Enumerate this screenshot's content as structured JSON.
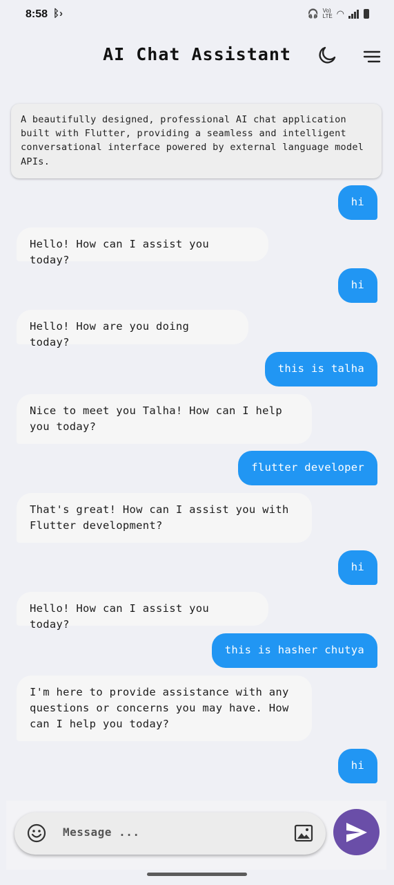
{
  "status_bar": {
    "time": "8:58",
    "network_label": "Vo) LTE"
  },
  "header": {
    "title": "AI Chat Assistant"
  },
  "description": "A beautifully designed, professional AI chat application built with Flutter, providing a seamless and intelligent conversational interface powered by external language model APIs.",
  "messages": [
    {
      "role": "user",
      "text": "hi"
    },
    {
      "role": "assistant",
      "text": "Hello! How can I assist you today?"
    },
    {
      "role": "user",
      "text": "hi"
    },
    {
      "role": "assistant",
      "text": "Hello! How are you doing today?"
    },
    {
      "role": "user",
      "text": "this is talha"
    },
    {
      "role": "assistant",
      "text": "Nice to meet you Talha! How can I help you today?"
    },
    {
      "role": "user",
      "text": "flutter developer"
    },
    {
      "role": "assistant",
      "text": "That's great! How can I assist you with Flutter development?"
    },
    {
      "role": "user",
      "text": "hi"
    },
    {
      "role": "assistant",
      "text": "Hello! How can I assist you today?"
    },
    {
      "role": "user",
      "text": "this is hasher chutya"
    },
    {
      "role": "assistant",
      "text": "I'm here to provide assistance with any questions or concerns you may have. How can I help you today?"
    },
    {
      "role": "user",
      "text": "hi"
    }
  ],
  "composer": {
    "placeholder": "Message ..."
  },
  "colors": {
    "user_bubble": "#2196f3",
    "bot_bubble": "#f6f6f6",
    "send_button": "#6a4ea8",
    "background": "#eff0f5"
  },
  "icons": [
    "moon-icon",
    "menu-icon",
    "emoji-icon",
    "image-icon",
    "send-icon"
  ]
}
